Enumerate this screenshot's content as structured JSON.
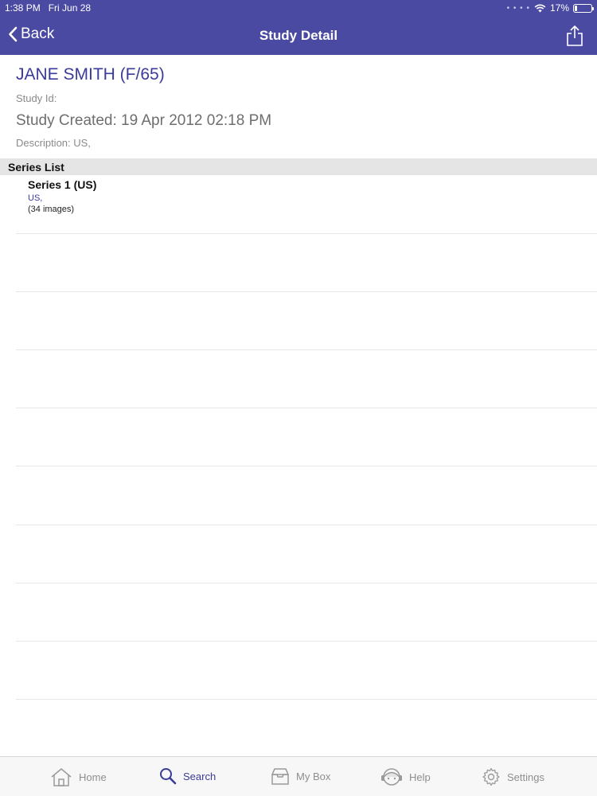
{
  "status_bar": {
    "time": "1:38 PM",
    "date": "Fri Jun 28",
    "battery": "17%"
  },
  "nav": {
    "back_label": "Back",
    "title": "Study Detail"
  },
  "study": {
    "patient": "JANE SMITH (F/65)",
    "study_id_label": "Study Id:",
    "created": "Study Created: 19 Apr 2012 02:18 PM",
    "description": "Description: US,"
  },
  "series_list": {
    "header": "Series List",
    "items": [
      {
        "name": "Series 1 (US)",
        "modality": "US,",
        "count": "(34 images)"
      }
    ]
  },
  "tabs": [
    {
      "label": "Home",
      "icon": "home-icon"
    },
    {
      "label": "Search",
      "icon": "search-icon",
      "active": true
    },
    {
      "label": "My Box",
      "icon": "inbox-icon"
    },
    {
      "label": "Help",
      "icon": "help-icon"
    },
    {
      "label": "Settings",
      "icon": "gear-icon"
    }
  ],
  "colors": {
    "accent": "#4a4aa3",
    "active_tab": "#3b3b9a",
    "section_header": "#e5e5e5"
  }
}
